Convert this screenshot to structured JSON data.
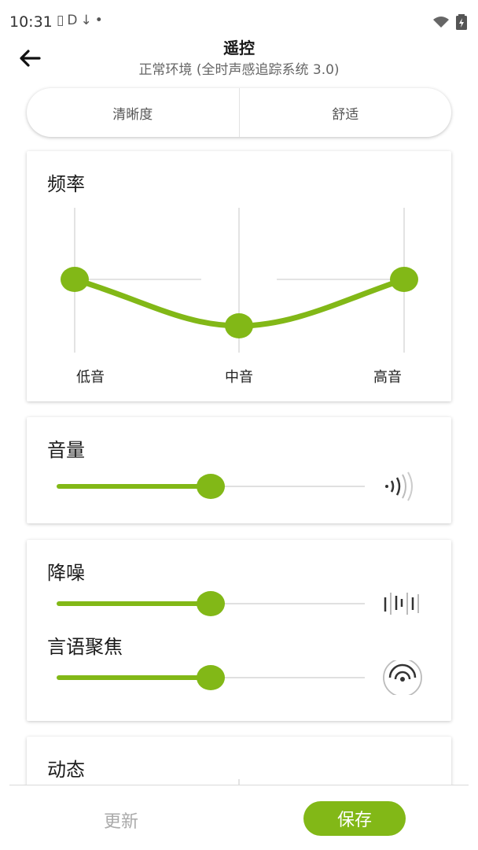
{
  "status_bar": {
    "time": "10:31",
    "left_icons": "▯D↓•"
  },
  "header": {
    "title": "遥控",
    "subtitle": "正常环境 (全时声感追踪系统 3.0)"
  },
  "tabs": [
    {
      "label": "清晰度"
    },
    {
      "label": "舒适"
    }
  ],
  "frequency": {
    "title": "频率",
    "bands": [
      {
        "label": "低音"
      },
      {
        "label": "中音"
      },
      {
        "label": "高音"
      }
    ]
  },
  "volume": {
    "title": "音量",
    "level": 0.5
  },
  "noise": {
    "title": "降噪",
    "noise_reduction_level": 0.5,
    "speech_focus_label": "言语聚焦",
    "speech_focus_level": 0.5
  },
  "dynamics": {
    "title": "动态"
  },
  "footer": {
    "update_label": "更新",
    "save_label": "保存"
  },
  "colors": {
    "accent": "#82b817",
    "track": "#e0e0e0"
  }
}
